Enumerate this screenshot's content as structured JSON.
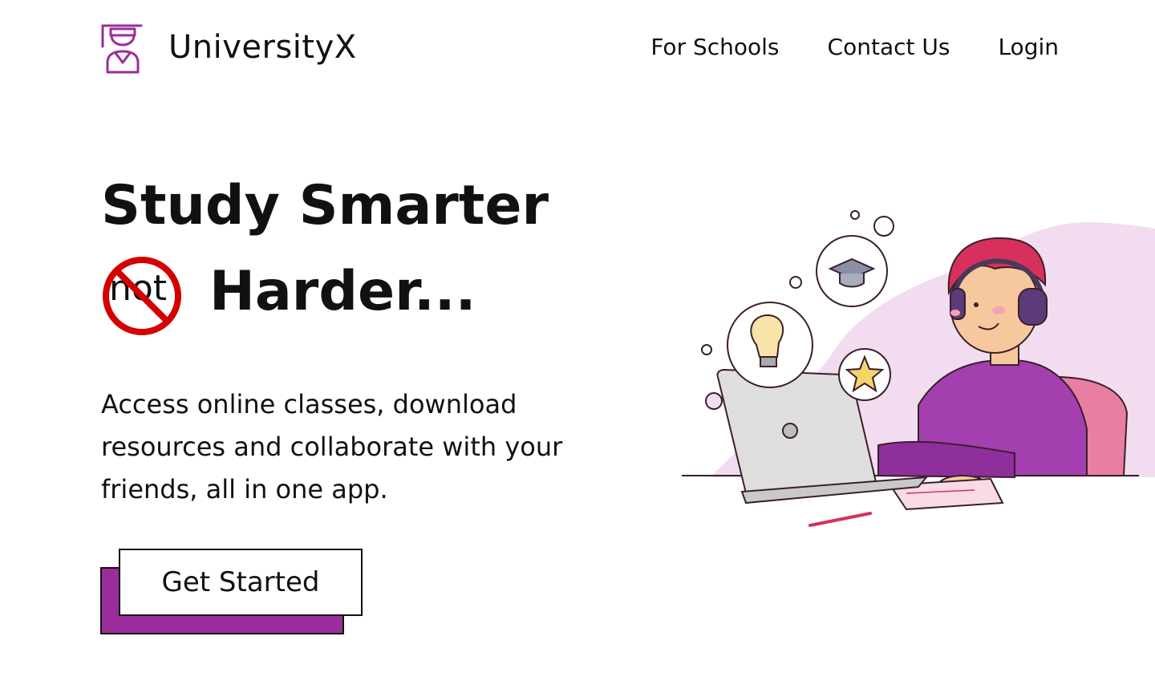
{
  "brand": {
    "name": "UniversityX",
    "accent_color": "#9b2c9b",
    "logo_icon": "graduate-icon"
  },
  "nav": {
    "items": [
      "For Schools",
      "Contact Us",
      "Login"
    ]
  },
  "hero": {
    "headline_line1": "Study Smarter",
    "not_word": "not",
    "headline_line2": "Harder...",
    "subtext": "Access online classes, download resources and collaborate with your friends, all in one app.",
    "cta_label": "Get Started",
    "illustration": "student-studying-illustration"
  },
  "colors": {
    "prohibition_red": "#d40000",
    "sweater_purple": "#a43fb0",
    "hair_pink": "#d8305c",
    "blob_lavender": "#f1dcf0"
  }
}
